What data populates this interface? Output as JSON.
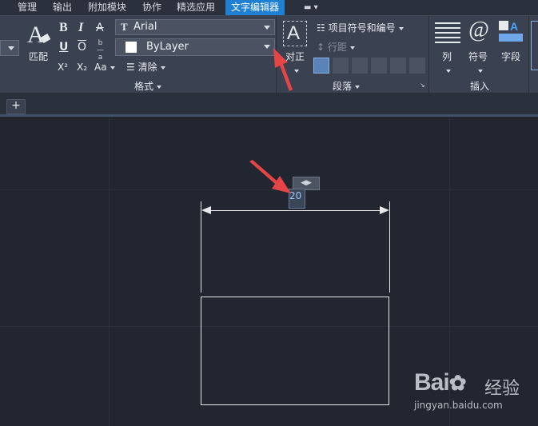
{
  "menu": {
    "tabs": [
      "管理",
      "输出",
      "附加模块",
      "协作",
      "精选应用",
      "文字编辑器"
    ],
    "active_tab": "文字编辑器"
  },
  "ribbon": {
    "style_group": {
      "match_label": "匹配",
      "group_label": "格式",
      "font_combo": "Arial",
      "color_combo": "ByLayer",
      "clear_label": "清除",
      "bold": "B",
      "italic": "I",
      "strike": "A",
      "underline": "U",
      "overline": "O",
      "superscript": "X²",
      "subscript": "X₂",
      "case": "Aa"
    },
    "paragraph_group": {
      "justify_label": "对正",
      "bullets_label": "项目符号和编号",
      "line_spacing_label": "行距",
      "group_label": "段落"
    },
    "insert_group": {
      "columns_label": "列",
      "symbol_label": "符号",
      "field_label": "字段",
      "group_label": "插入"
    }
  },
  "tabbar": {
    "add_label": "+"
  },
  "canvas": {
    "dimension_value": "20"
  },
  "watermark": {
    "logo": "Bai",
    "logo_suffix": "经验",
    "url": "jingyan.baidu.com"
  },
  "colors": {
    "accent": "#1f7fd0",
    "annotation": "#e64545",
    "canvas_bg": "#212630"
  }
}
